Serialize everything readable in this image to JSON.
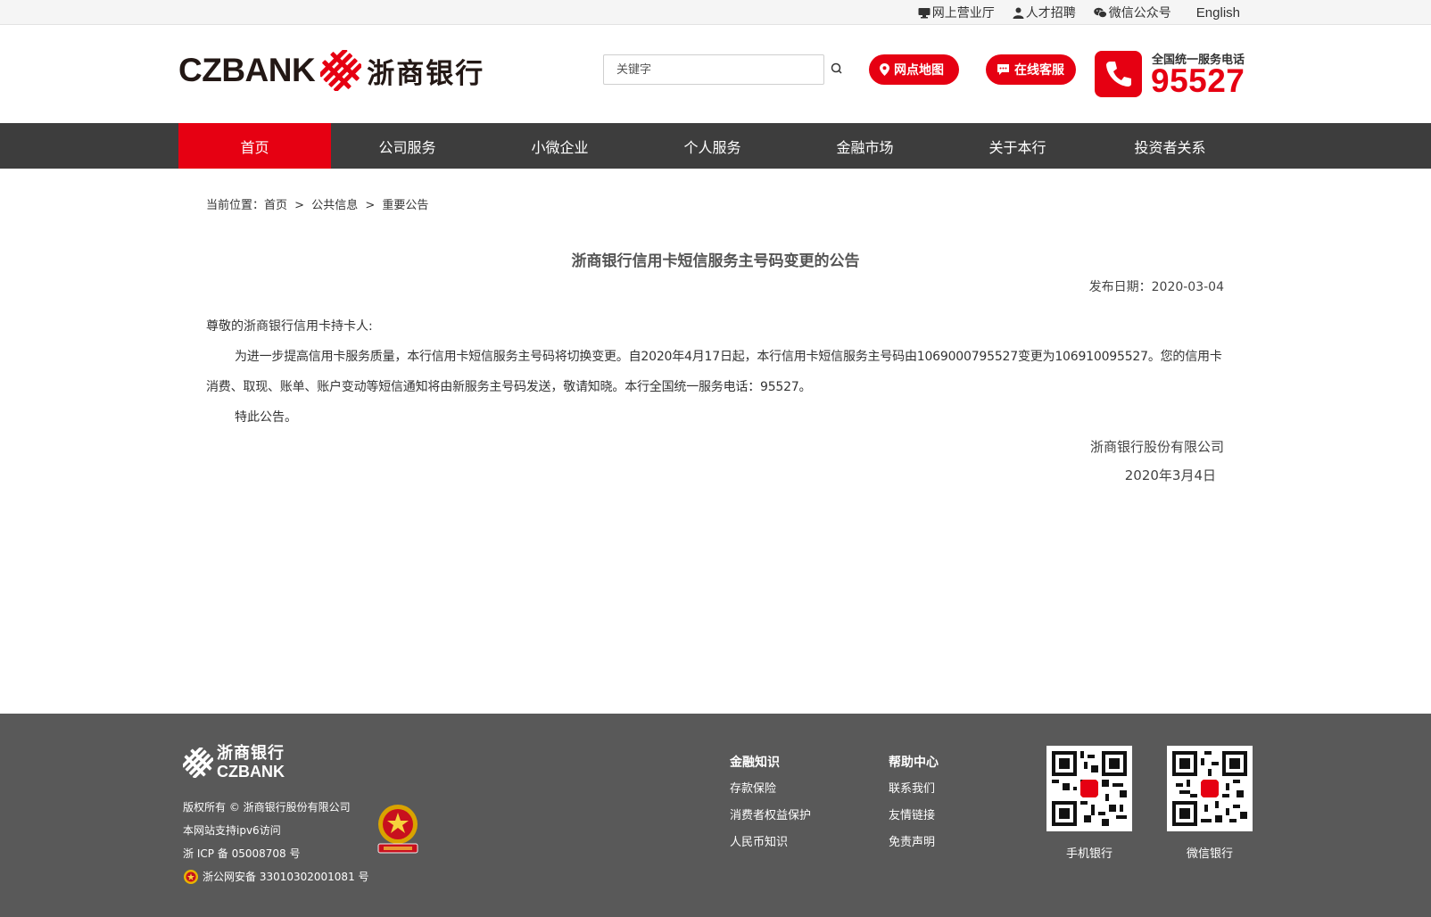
{
  "topbar": {
    "links": [
      {
        "label": "网上营业厅",
        "icon": "monitor-icon"
      },
      {
        "label": "人才招聘",
        "icon": "person-icon"
      },
      {
        "label": "微信公众号",
        "icon": "wechat-icon"
      }
    ],
    "english": "English"
  },
  "header": {
    "logo_en": "CZBANK",
    "logo_cn": "浙商银行",
    "search_placeholder": "关键字",
    "map_button": "网点地图",
    "service_button": "在线客服",
    "hotline_label": "全国统一服务电话",
    "hotline_number": "95527"
  },
  "nav": {
    "items": [
      "首页",
      "公司服务",
      "小微企业",
      "个人服务",
      "金融市场",
      "关于本行",
      "投资者关系"
    ]
  },
  "breadcrumb": {
    "prefix": "当前位置：",
    "items": [
      "首页",
      "公共信息",
      "重要公告"
    ],
    "separator": ">"
  },
  "article": {
    "title": "浙商银行信用卡短信服务主号码变更的公告",
    "pubdate": "发布日期：2020-03-04",
    "salutation": "尊敬的浙商银行信用卡持卡人:",
    "paragraph": "为进一步提高信用卡服务质量，本行信用卡短信服务主号码将切换变更。自2020年4月17日起，本行信用卡短信服务主号码由1069000795527变更为106910095527。您的信用卡消费、取现、账单、账户变动等短信通知将由新服务主号码发送，敬请知晓。本行全国统一服务电话：95527。",
    "closing": "特此公告。",
    "signer": "浙商银行股份有限公司",
    "signdate": "2020年3月4日"
  },
  "footer": {
    "logo_cn": "浙商银行",
    "logo_en": "CZBANK",
    "copyright": "版权所有 © 浙商银行股份有限公司",
    "ipv6": "本网站支持ipv6访问",
    "icp": "浙 ICP 备 05008708 号",
    "police": "浙公网安备 33010302001081 号",
    "col1": [
      "金融知识",
      "存款保险",
      "消费者权益保护",
      "人民币知识"
    ],
    "col2": [
      "帮助中心",
      "联系我们",
      "友情链接",
      "免责声明"
    ],
    "qr1_label": "手机银行",
    "qr2_label": "微信银行"
  },
  "colors": {
    "brand_red": "#e60012",
    "nav_bg": "#3d3d3d",
    "footer_bg": "#595959"
  }
}
